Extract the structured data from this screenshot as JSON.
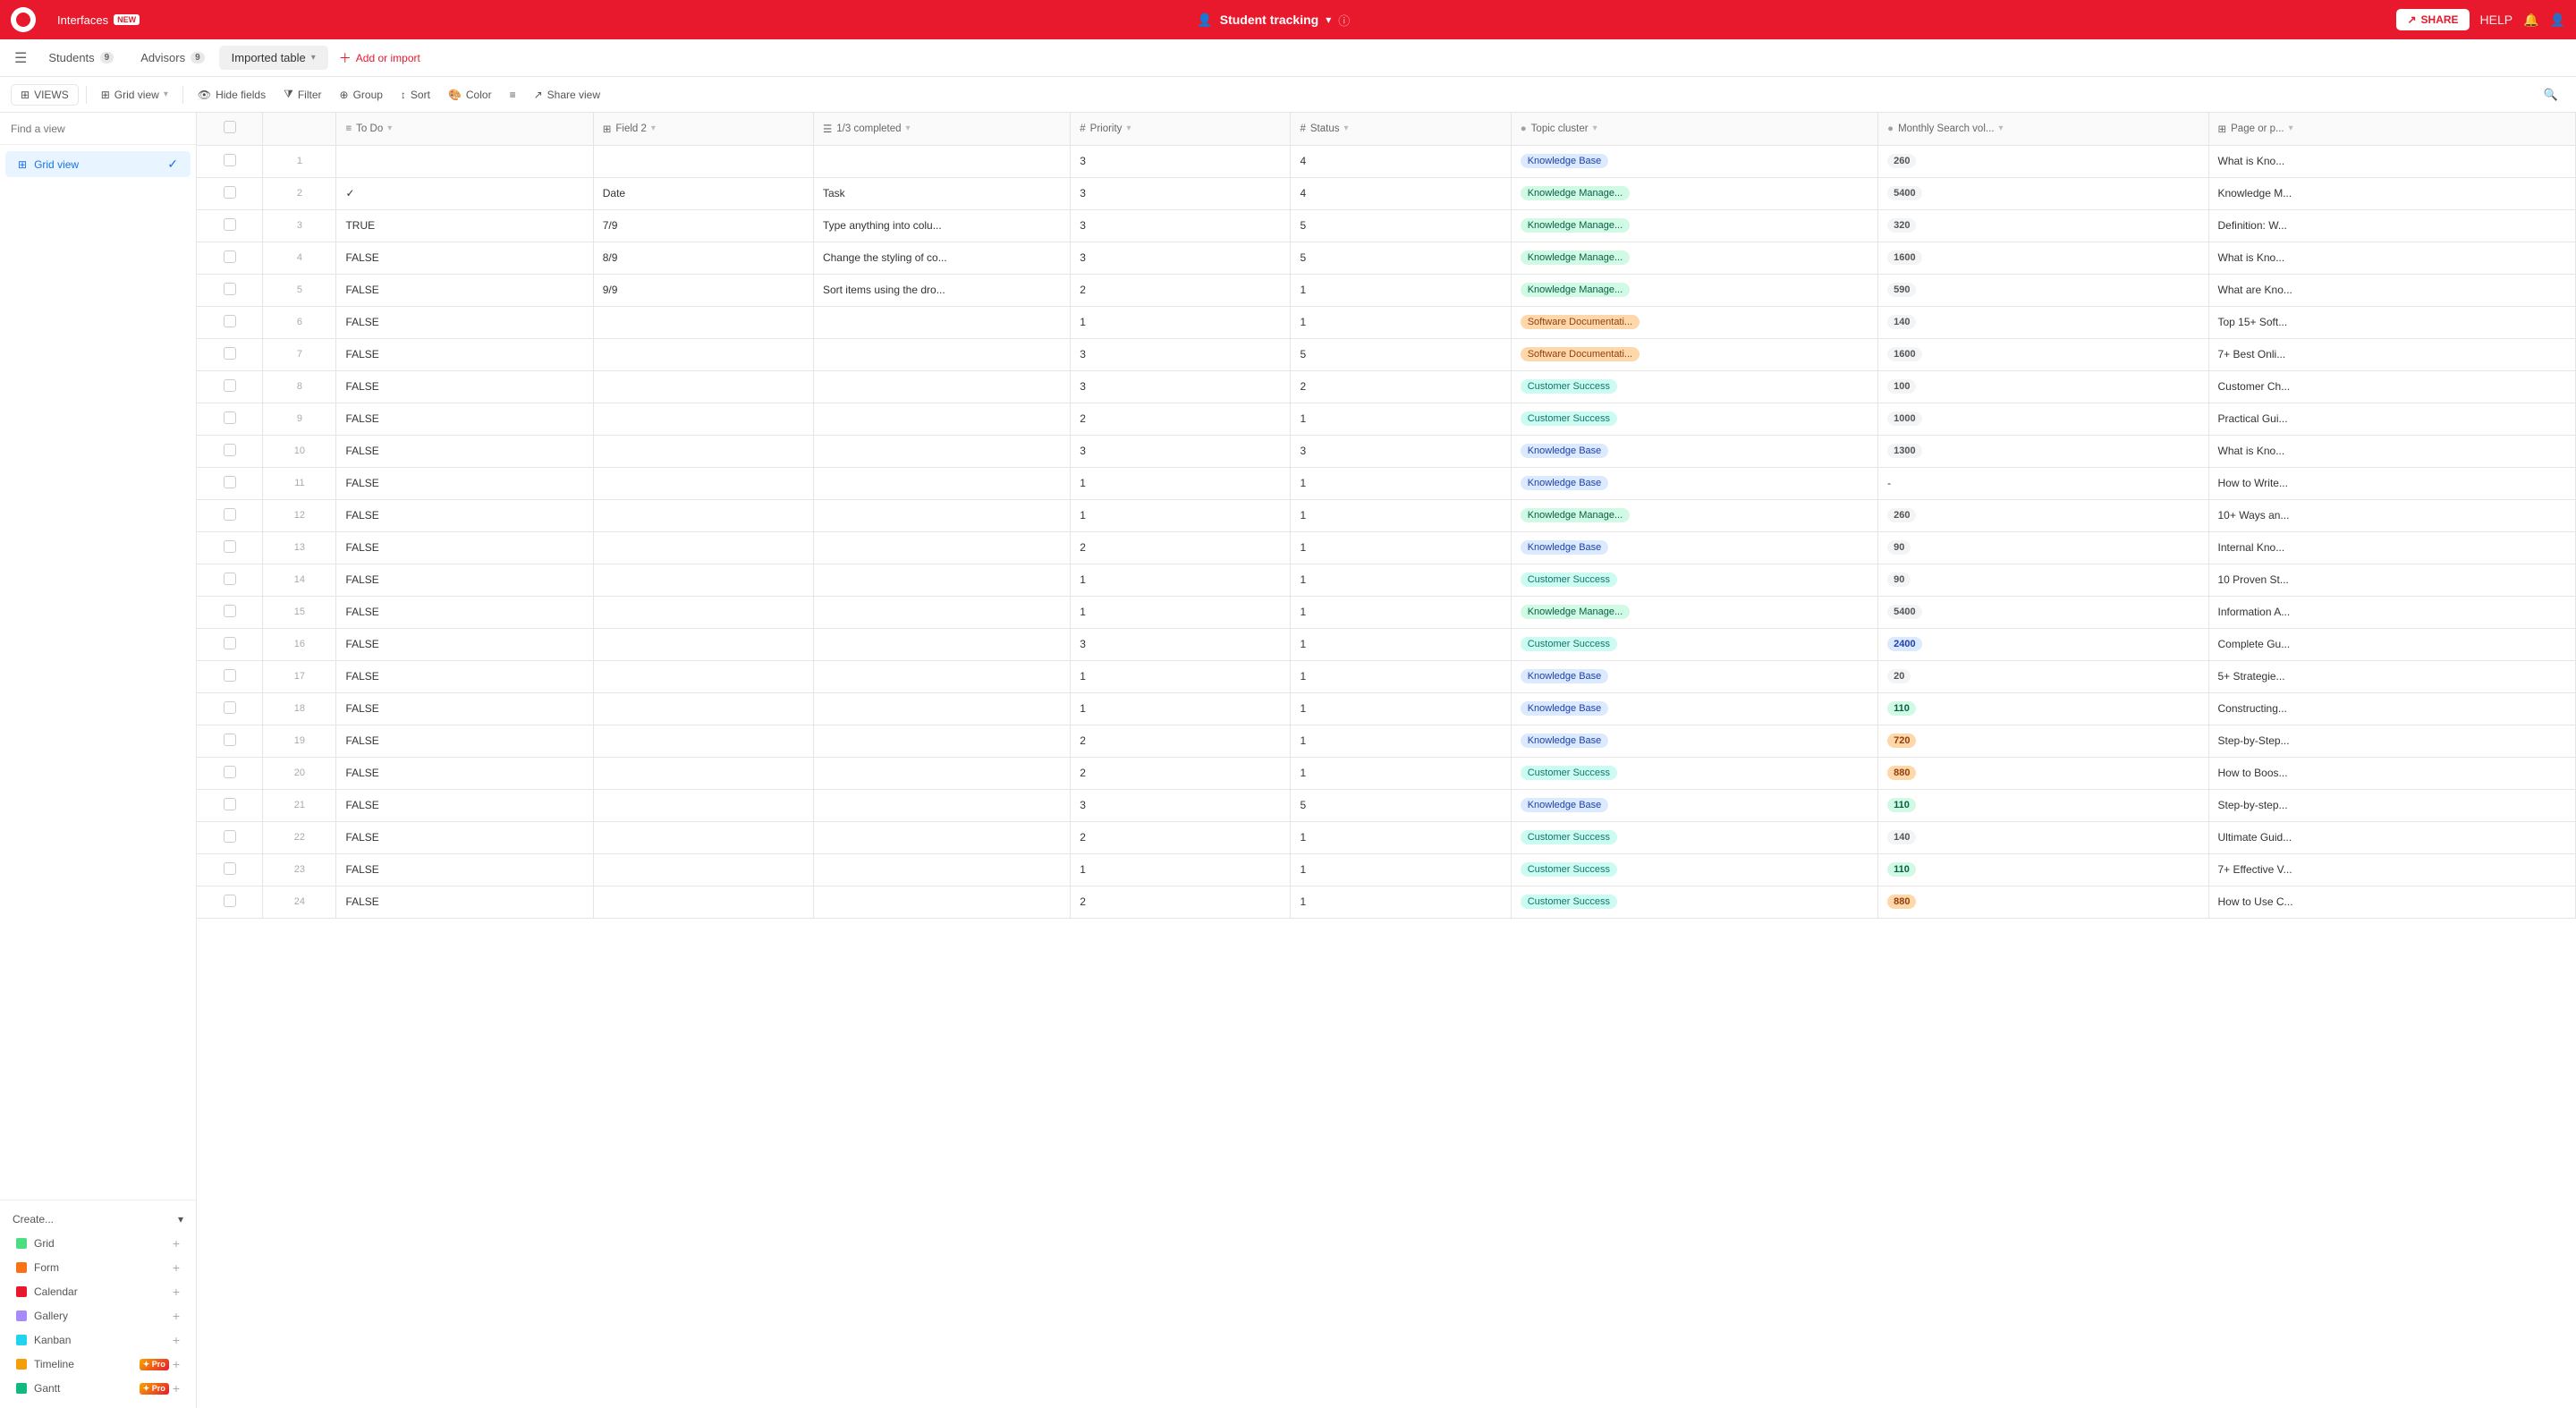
{
  "topNav": {
    "appName": "Interfaces",
    "newBadge": "NEW",
    "workspaceTitle": "Student tracking",
    "shareLabel": "SHARE",
    "helpLabel": "HELP"
  },
  "tabs": [
    {
      "id": "students",
      "label": "Students",
      "badge": "9"
    },
    {
      "id": "advisors",
      "label": "Advisors",
      "badge": "9"
    },
    {
      "id": "imported",
      "label": "Imported table",
      "active": true
    }
  ],
  "addTabLabel": "Add or import",
  "toolbar": {
    "viewsLabel": "VIEWS",
    "gridViewLabel": "Grid view",
    "hideFieldsLabel": "Hide fields",
    "filterLabel": "Filter",
    "groupLabel": "Group",
    "sortLabel": "Sort",
    "colorLabel": "Color",
    "shareViewLabel": "Share view"
  },
  "sidebar": {
    "searchPlaceholder": "Find a view",
    "views": [
      {
        "id": "grid",
        "label": "Grid view",
        "active": true
      }
    ],
    "createLabel": "Create...",
    "createItems": [
      {
        "id": "grid",
        "label": "Grid",
        "color": "#4ade80"
      },
      {
        "id": "form",
        "label": "Form",
        "color": "#f97316"
      },
      {
        "id": "calendar",
        "label": "Calendar",
        "color": "#e8192c"
      },
      {
        "id": "gallery",
        "label": "Gallery",
        "color": "#a78bfa"
      },
      {
        "id": "kanban",
        "label": "Kanban",
        "color": "#22d3ee"
      },
      {
        "id": "timeline",
        "label": "Timeline",
        "color": "#f59e0b",
        "pro": true
      },
      {
        "id": "gantt",
        "label": "Gantt",
        "color": "#10b981",
        "pro": true
      }
    ]
  },
  "table": {
    "columns": [
      {
        "id": "todo",
        "label": "To Do",
        "icon": "list"
      },
      {
        "id": "field2",
        "label": "Field 2",
        "icon": "field"
      },
      {
        "id": "completed",
        "label": "1/3 completed",
        "icon": "check"
      },
      {
        "id": "priority",
        "label": "Priority",
        "icon": "hash"
      },
      {
        "id": "status",
        "label": "Status",
        "icon": "hash"
      },
      {
        "id": "topic",
        "label": "Topic cluster",
        "icon": "circle"
      },
      {
        "id": "search",
        "label": "Monthly Search vol...",
        "icon": "circle2"
      },
      {
        "id": "page",
        "label": "Page or p...",
        "icon": "grid"
      }
    ],
    "rows": [
      {
        "num": 1,
        "todo": "",
        "field2": "",
        "completed": "",
        "priority": 3,
        "status": 4,
        "topic": "Knowledge Base",
        "topicColor": "blue",
        "search": 260,
        "searchColor": "gray",
        "page": "What is Kno..."
      },
      {
        "num": 2,
        "todo": "✓",
        "field2": "Date",
        "completed": "Task",
        "priority": 3,
        "status": 4,
        "topic": "Knowledge Manage...",
        "topicColor": "green",
        "search": 5400,
        "searchColor": "gray",
        "page": "Knowledge M..."
      },
      {
        "num": 3,
        "todo": "TRUE",
        "field2": "7/9",
        "completed": "Type anything into colu...",
        "priority": 3,
        "status": 5,
        "topic": "Knowledge Manage...",
        "topicColor": "green",
        "search": 320,
        "searchColor": "gray",
        "page": "Definition: W..."
      },
      {
        "num": 4,
        "todo": "FALSE",
        "field2": "8/9",
        "completed": "Change the styling of co...",
        "priority": 3,
        "status": 5,
        "topic": "Knowledge Manage...",
        "topicColor": "green",
        "search": 1600,
        "searchColor": "gray",
        "page": "What is Kno..."
      },
      {
        "num": 5,
        "todo": "FALSE",
        "field2": "9/9",
        "completed": "Sort items using the dro...",
        "priority": 2,
        "status": 1,
        "topic": "Knowledge Manage...",
        "topicColor": "green",
        "search": 590,
        "searchColor": "gray",
        "page": "What are Kno..."
      },
      {
        "num": 6,
        "todo": "FALSE",
        "field2": "",
        "completed": "",
        "priority": 1,
        "status": 1,
        "topic": "Software Documentati...",
        "topicColor": "orange",
        "search": 140,
        "searchColor": "gray",
        "page": "Top 15+ Soft..."
      },
      {
        "num": 7,
        "todo": "FALSE",
        "field2": "",
        "completed": "",
        "priority": 3,
        "status": 5,
        "topic": "Software Documentati...",
        "topicColor": "orange",
        "search": 1600,
        "searchColor": "gray",
        "page": "7+ Best Onli..."
      },
      {
        "num": 8,
        "todo": "FALSE",
        "field2": "",
        "completed": "",
        "priority": 3,
        "status": 2,
        "topic": "Customer Success",
        "topicColor": "teal",
        "search": 100,
        "searchColor": "gray",
        "page": "Customer Ch..."
      },
      {
        "num": 9,
        "todo": "FALSE",
        "field2": "",
        "completed": "",
        "priority": 2,
        "status": 1,
        "topic": "Customer Success",
        "topicColor": "teal",
        "search": 1000,
        "searchColor": "gray",
        "page": "Practical Gui..."
      },
      {
        "num": 10,
        "todo": "FALSE",
        "field2": "",
        "completed": "",
        "priority": 3,
        "status": 3,
        "topic": "Knowledge Base",
        "topicColor": "blue",
        "search": 1300,
        "searchColor": "gray",
        "page": "What is Kno..."
      },
      {
        "num": 11,
        "todo": "FALSE",
        "field2": "",
        "completed": "",
        "priority": 1,
        "status": 1,
        "topic": "Knowledge Base",
        "topicColor": "blue",
        "search": "-",
        "searchColor": "none",
        "page": "How to Write..."
      },
      {
        "num": 12,
        "todo": "FALSE",
        "field2": "",
        "completed": "",
        "priority": 1,
        "status": 1,
        "topic": "Knowledge Manage...",
        "topicColor": "green",
        "search": 260,
        "searchColor": "gray",
        "page": "10+ Ways an..."
      },
      {
        "num": 13,
        "todo": "FALSE",
        "field2": "",
        "completed": "",
        "priority": 2,
        "status": 1,
        "topic": "Knowledge Base",
        "topicColor": "blue",
        "search": 90,
        "searchColor": "gray",
        "page": "Internal Kno..."
      },
      {
        "num": 14,
        "todo": "FALSE",
        "field2": "",
        "completed": "",
        "priority": 1,
        "status": 1,
        "topic": "Customer Success",
        "topicColor": "teal",
        "search": 90,
        "searchColor": "gray",
        "page": "10 Proven St..."
      },
      {
        "num": 15,
        "todo": "FALSE",
        "field2": "",
        "completed": "",
        "priority": 1,
        "status": 1,
        "topic": "Knowledge Manage...",
        "topicColor": "green",
        "search": 5400,
        "searchColor": "gray",
        "page": "Information A..."
      },
      {
        "num": 16,
        "todo": "FALSE",
        "field2": "",
        "completed": "",
        "priority": 3,
        "status": 1,
        "topic": "Customer Success",
        "topicColor": "teal",
        "search": 2400,
        "searchColor": "blue",
        "page": "Complete Gu..."
      },
      {
        "num": 17,
        "todo": "FALSE",
        "field2": "",
        "completed": "",
        "priority": 1,
        "status": 1,
        "topic": "Knowledge Base",
        "topicColor": "blue",
        "search": 20,
        "searchColor": "gray",
        "page": "5+ Strategie..."
      },
      {
        "num": 18,
        "todo": "FALSE",
        "field2": "",
        "completed": "",
        "priority": 1,
        "status": 1,
        "topic": "Knowledge Base",
        "topicColor": "blue",
        "search": 110,
        "searchColor": "green",
        "page": "Constructing..."
      },
      {
        "num": 19,
        "todo": "FALSE",
        "field2": "",
        "completed": "",
        "priority": 2,
        "status": 1,
        "topic": "Knowledge Base",
        "topicColor": "blue",
        "search": 720,
        "searchColor": "orange",
        "page": "Step-by-Step..."
      },
      {
        "num": 20,
        "todo": "FALSE",
        "field2": "",
        "completed": "",
        "priority": 2,
        "status": 1,
        "topic": "Customer Success",
        "topicColor": "teal",
        "search": 880,
        "searchColor": "orange",
        "page": "How to Boos..."
      },
      {
        "num": 21,
        "todo": "FALSE",
        "field2": "",
        "completed": "",
        "priority": 3,
        "status": 5,
        "topic": "Knowledge Base",
        "topicColor": "blue",
        "search": 110,
        "searchColor": "green",
        "page": "Step-by-step..."
      },
      {
        "num": 22,
        "todo": "FALSE",
        "field2": "",
        "completed": "",
        "priority": 2,
        "status": 1,
        "topic": "Customer Success",
        "topicColor": "teal",
        "search": 140,
        "searchColor": "gray",
        "page": "Ultimate Guid..."
      },
      {
        "num": 23,
        "todo": "FALSE",
        "field2": "",
        "completed": "",
        "priority": 1,
        "status": 1,
        "topic": "Customer Success",
        "topicColor": "teal",
        "search": 110,
        "searchColor": "green",
        "page": "7+ Effective V..."
      },
      {
        "num": 24,
        "todo": "FALSE",
        "field2": "",
        "completed": "",
        "priority": 2,
        "status": 1,
        "topic": "Customer Success",
        "topicColor": "teal",
        "search": 880,
        "searchColor": "orange",
        "page": "How to Use C..."
      }
    ]
  }
}
